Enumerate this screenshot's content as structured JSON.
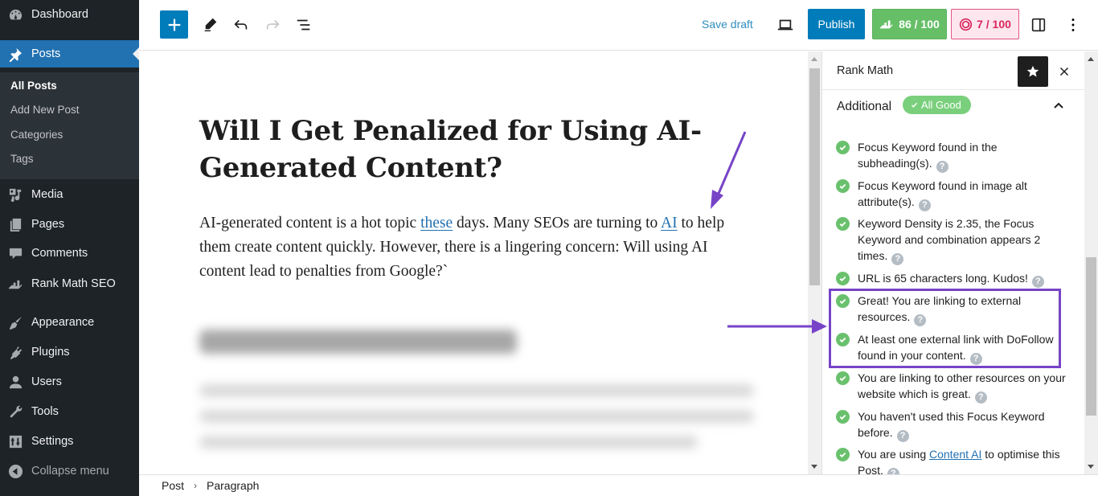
{
  "admin_menu": {
    "items": [
      {
        "label": "Dashboard",
        "icon": "dashboard-icon"
      },
      {
        "label": "Posts",
        "icon": "pin-icon",
        "current": true
      },
      {
        "label": "Media",
        "icon": "media-icon"
      },
      {
        "label": "Pages",
        "icon": "pages-icon"
      },
      {
        "label": "Comments",
        "icon": "comment-icon"
      },
      {
        "label": "Rank Math SEO",
        "icon": "rank-math-icon"
      },
      {
        "label": "Appearance",
        "icon": "brush-icon"
      },
      {
        "label": "Plugins",
        "icon": "plugin-icon"
      },
      {
        "label": "Users",
        "icon": "user-icon"
      },
      {
        "label": "Tools",
        "icon": "wrench-icon"
      },
      {
        "label": "Settings",
        "icon": "settings-icon"
      }
    ],
    "submenu": [
      {
        "label": "All Posts",
        "current": true
      },
      {
        "label": "Add New Post"
      },
      {
        "label": "Categories"
      },
      {
        "label": "Tags"
      }
    ],
    "collapse_label": "Collapse menu"
  },
  "toolbar": {
    "save_draft": "Save draft",
    "publish": "Publish",
    "seo_score": "86 / 100",
    "content_ai_score": "7 / 100",
    "colors": {
      "primary": "#007cba",
      "seo_good": "#66bf67",
      "ai_accent": "#d9285f"
    }
  },
  "post": {
    "title": "Will I Get Penalized for Using AI-Generated Content?",
    "paragraph": {
      "part1": "AI-generated content is a hot topic ",
      "link1": "these",
      "part2": " days. Many SEOs are turning to ",
      "link2": "AI",
      "part3": " to help them create content quickly. However, there is a lingering concern: Will using AI content lead to penalties from Google?`"
    }
  },
  "breadcrumb": {
    "items": [
      "Post",
      "Paragraph"
    ],
    "separator": "›"
  },
  "rank_math": {
    "panel_title": "Rank Math",
    "section_title": "Additional",
    "section_badge": "All Good",
    "checks": [
      {
        "text": "Focus Keyword found in the subheading(s)."
      },
      {
        "text": "Focus Keyword found in image alt attribute(s)."
      },
      {
        "text": "Keyword Density is 2.35, the Focus Keyword and combination appears 2 times."
      },
      {
        "text": "URL is 65 characters long. Kudos!"
      },
      {
        "text": "Great! You are linking to external resources.",
        "highlighted": true
      },
      {
        "text": "At least one external link with DoFollow found in your content.",
        "highlighted": true
      },
      {
        "text": "You are linking to other resources on your website which is great."
      },
      {
        "text": "You haven't used this Focus Keyword before."
      },
      {
        "text_before": "You are using ",
        "link": "Content AI",
        "text_after": " to optimise this Post."
      }
    ],
    "help_glyph": "?",
    "highlight_color": "#7744c7"
  }
}
